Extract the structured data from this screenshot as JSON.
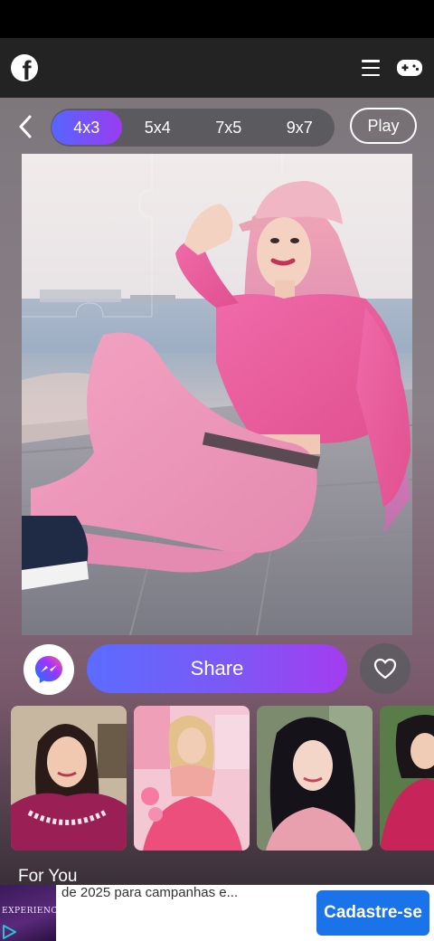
{
  "header": {
    "logo_icon": "facebook-icon",
    "menu_icon": "hamburger-menu-icon",
    "games_icon": "gamepad-icon"
  },
  "puzzle_controls": {
    "back_icon": "chevron-left-icon",
    "sizes": [
      {
        "label": "4x3",
        "selected": true
      },
      {
        "label": "5x4",
        "selected": false
      },
      {
        "label": "7x5",
        "selected": false
      },
      {
        "label": "9x7",
        "selected": false
      }
    ],
    "play_label": "Play"
  },
  "actions": {
    "messenger_icon": "messenger-icon",
    "share_label": "Share",
    "favorite_icon": "heart-icon"
  },
  "for_you": {
    "title": "For You"
  },
  "ad": {
    "image_text": "EXPERIENCE",
    "text": "de 2025 para campanhas e...",
    "cta_label": "Cadastre-se"
  },
  "colors": {
    "accent_gradient_start": "#5566ff",
    "accent_gradient_end": "#a43cf0",
    "cta_blue": "#1a73e8"
  }
}
